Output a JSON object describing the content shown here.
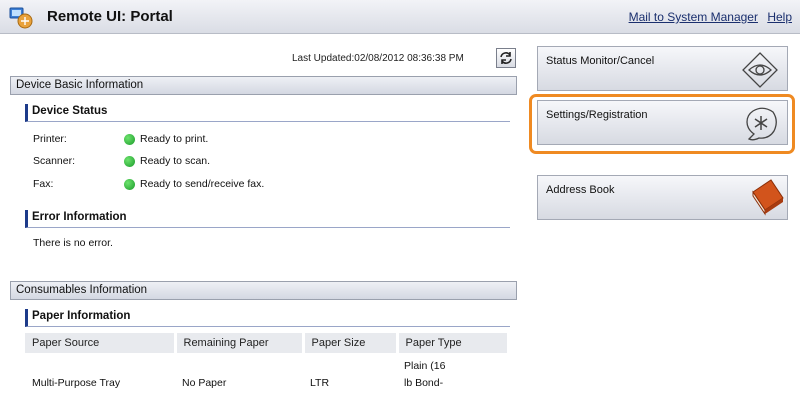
{
  "header": {
    "title": "Remote UI: Portal",
    "links": {
      "mail": "Mail to System Manager",
      "help": "Help"
    }
  },
  "last_updated": "Last Updated:02/08/2012 08:36:38 PM",
  "device_basic": {
    "title": "Device Basic Information",
    "status_title": "Device Status",
    "rows": [
      {
        "label": "Printer:",
        "value": "Ready to print."
      },
      {
        "label": "Scanner:",
        "value": "Ready to scan."
      },
      {
        "label": "Fax:",
        "value": "Ready to send/receive fax."
      }
    ],
    "error_title": "Error Information",
    "error_text": "There is no error."
  },
  "consumables": {
    "title": "Consumables Information",
    "paper_title": "Paper Information",
    "columns": [
      "Paper Source",
      "Remaining Paper",
      "Paper Size",
      "Paper Type"
    ],
    "rows": [
      {
        "source": "Multi-Purpose Tray",
        "remaining": "No Paper",
        "size": "LTR",
        "type_lines": [
          "Plain (16",
          "lb Bond-"
        ]
      }
    ]
  },
  "side_buttons": {
    "status_monitor": "Status Monitor/Cancel",
    "settings": "Settings/Registration",
    "address_book": "Address Book"
  },
  "colors": {
    "status_ready": "#22aa33",
    "highlight": "#ef8a22",
    "section_accent": "#1d3b8a"
  },
  "icons": {
    "logo": "remote-ui-logo-icon",
    "refresh": "refresh-icon",
    "status_monitor": "eye-diamond-icon",
    "settings": "asterisk-hand-icon",
    "address_book": "book-icon"
  }
}
